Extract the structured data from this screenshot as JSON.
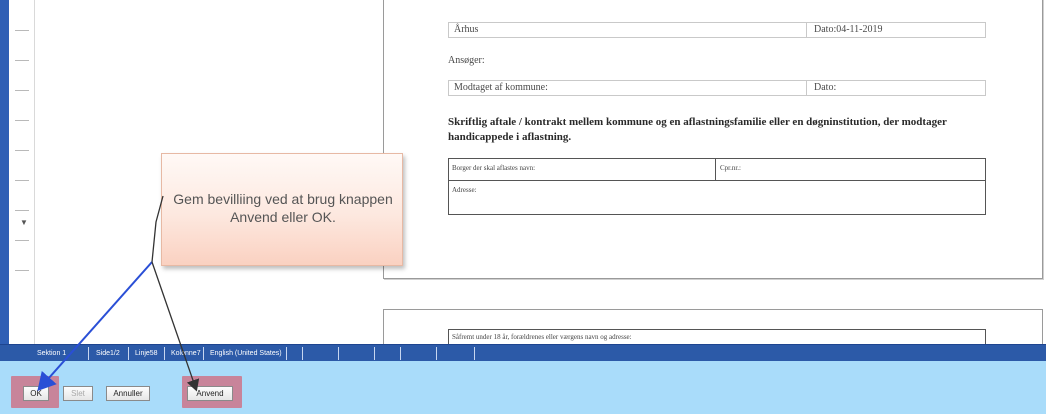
{
  "document": {
    "city": "Århus",
    "date_label": "Dato:04-11-2019",
    "applicant_label": "Ansøger:",
    "received_label": "Modtaget af kommune:",
    "received_date_label": "Dato:",
    "heading": "Skriftlig aftale / kontrakt mellem kommune og en aflastningsfamilie eller en døgninstitution, der modtager handicappede i aflastning.",
    "table": {
      "citizen_name_label": "Borger der skal aflastes navn:",
      "cpr_label": "Cpr.nr.:",
      "address_label": "Adresse:"
    },
    "page2_row_label": "Såfremt under 18 år, forældrenes eller værgens navn og adresse:"
  },
  "callout": {
    "text": "Gem bevilliing ved at brug knappen Anvend eller OK."
  },
  "statusbar": {
    "section": "Sektion 1",
    "page": "Side1/2",
    "line": "Linje58",
    "column": "Kolonne7",
    "language": "English (United States)"
  },
  "buttons": {
    "ok": "OK",
    "delete": "Slet",
    "cancel": "Annuller",
    "apply": "Anvend"
  },
  "colors": {
    "statusbar": "#2c5aa8",
    "buttonbar": "#a9dcfa",
    "highlight": "#e23c4b",
    "arrow": "#2a4fd6"
  }
}
